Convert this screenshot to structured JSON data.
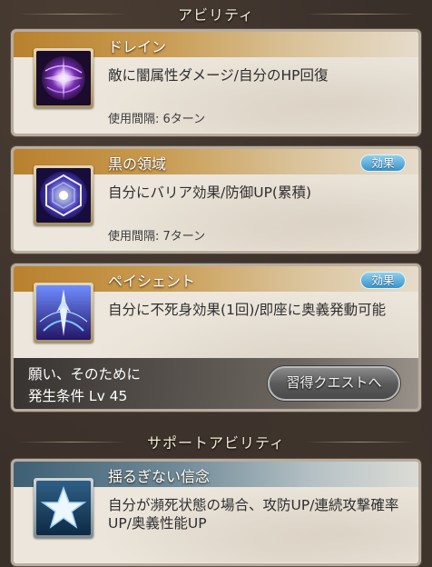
{
  "sections": {
    "ability_header": "アビリティ",
    "support_header": "サポートアビリティ"
  },
  "abilities": [
    {
      "name": "ドレイン",
      "description": "敵に闇属性ダメージ/自分のHP回復",
      "cooldown": "使用間隔: 6ターン",
      "icon": "drain-orb-icon",
      "has_effect_badge": false
    },
    {
      "name": "黒の領域",
      "description": "自分にバリア効果/防御UP(累積)",
      "cooldown": "使用間隔: 7ターン",
      "icon": "hexagon-barrier-icon",
      "has_effect_badge": true,
      "effect_label": "効果"
    },
    {
      "name": "ペイシェント",
      "description": "自分に不死身効果(1回)/即座に奥義発動可能",
      "icon": "spear-light-icon",
      "has_effect_badge": true,
      "effect_label": "効果",
      "locked": {
        "wish": "願い、そのために",
        "condition": "発生条件 Lv 45",
        "quest_button": "習得クエストへ"
      }
    }
  ],
  "support_abilities": [
    {
      "name": "揺るぎない信念",
      "description": "自分が瀕死状態の場合、攻防UP/連続攻撃確率UP/奥義性能UP",
      "icon": "star-icon"
    }
  ],
  "colors": {
    "ability_title_bar": "#b9812e",
    "support_title_bar": "#3e5f74",
    "effect_badge": "#3a93c9",
    "background": "#3a302a"
  }
}
